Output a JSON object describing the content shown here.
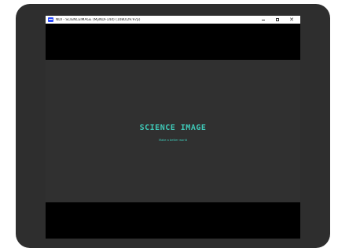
{
  "window": {
    "title": "NDI - SCIENCEIMAGE (MyNDI-14d) (1080/29.97p)",
    "controls": {
      "minimize": "–",
      "maximize": "□",
      "close": "✕"
    },
    "app_icon": "ndi-app-icon"
  },
  "content": {
    "brand_title": "SCIENCE IMAGE",
    "tagline": "Make a better world"
  },
  "colors": {
    "device_bezel": "#2e2e2e",
    "letterbox": "#000000",
    "brand_accent": "#3fc9b8",
    "app_icon": "#2b4cff"
  }
}
